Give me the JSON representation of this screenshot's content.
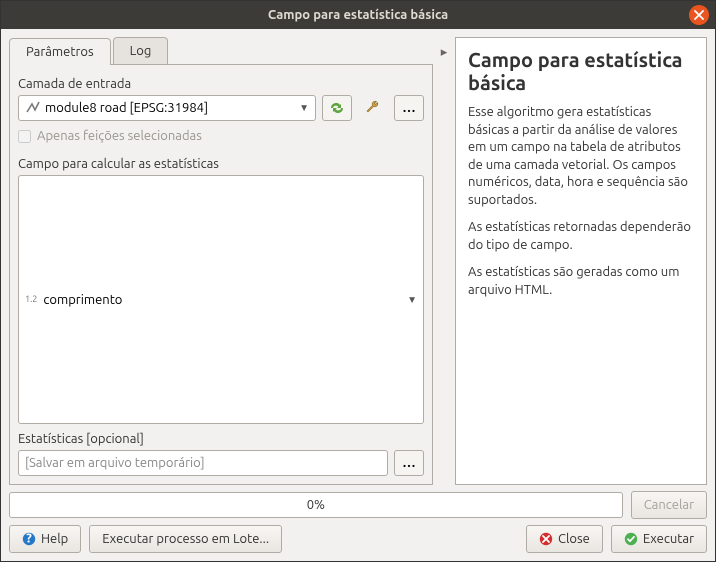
{
  "window": {
    "title": "Campo para estatística básica"
  },
  "tabs": {
    "parametros": "Parâmetros",
    "log": "Log"
  },
  "params": {
    "input_layer_label": "Camada de entrada",
    "input_layer_value": "module8 road [EPSG:31984]",
    "only_selected": "Apenas feições selecionadas",
    "field_label": "Campo para calcular as estatísticas",
    "field_type_prefix": "1.2",
    "field_value": "comprimento",
    "stats_label": "Estatísticas [opcional]",
    "stats_placeholder": "[Salvar em arquivo temporário]"
  },
  "help": {
    "title": "Campo para estatística básica",
    "p1": "Esse algoritmo gera estatísticas básicas a partir da análise de valores em um campo na tabela de atributos de uma camada vetorial. Os campos numéricos, data, hora e sequência são suportados.",
    "p2": "As estatísticas retornadas dependerão do tipo de campo.",
    "p3": "As estatísticas são geradas como um arquivo HTML."
  },
  "progress": {
    "text": "0%",
    "cancel": "Cancelar"
  },
  "buttons": {
    "help": "Help",
    "batch": "Executar processo em Lote...",
    "close": "Close",
    "run": "Executar"
  }
}
